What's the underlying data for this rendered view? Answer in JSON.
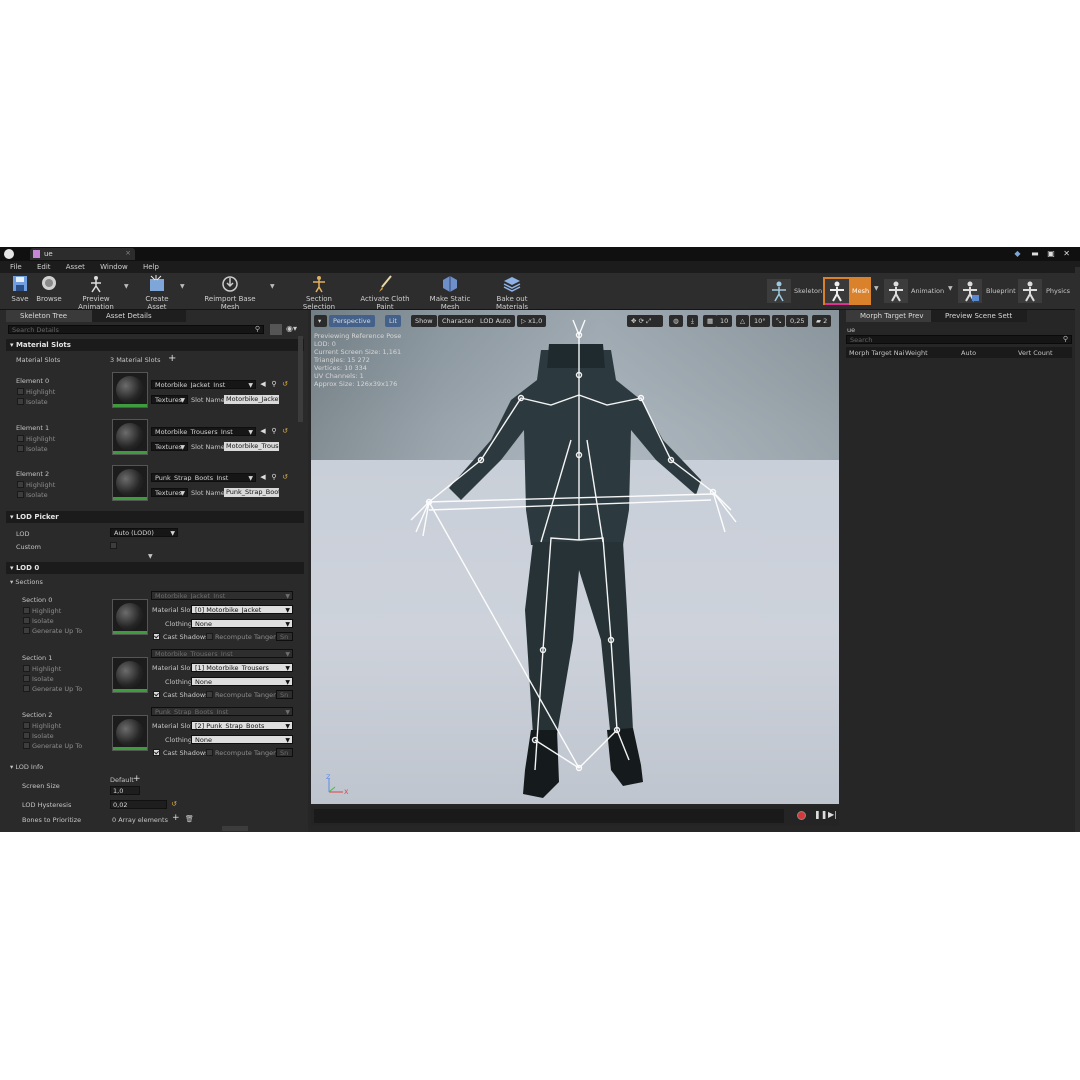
{
  "titlebar": {
    "tab_title": "ue",
    "window_buttons": [
      "minimize-icon",
      "maximize-icon",
      "close-icon"
    ]
  },
  "menu": [
    "File",
    "Edit",
    "Asset",
    "Window",
    "Help"
  ],
  "toolbar": {
    "save": "Save",
    "browse": "Browse",
    "preview_animation": "Preview Animation",
    "create_asset": "Create Asset",
    "reimport_base_mesh": "Reimport Base Mesh",
    "section_selection": "Section Selection",
    "activate_cloth_paint": "Activate Cloth Paint",
    "make_static_mesh": "Make Static Mesh",
    "bake_out_materials": "Bake out Materials"
  },
  "modes": {
    "skeleton": "Skeleton",
    "mesh": "Mesh",
    "animation": "Animation",
    "blueprint": "Blueprint",
    "physics": "Physics",
    "active": "Mesh"
  },
  "left_tabs": {
    "skeleton_tree": "Skeleton Tree",
    "asset_details": "Asset Details"
  },
  "details": {
    "search_placeholder": "Search Details",
    "material_slots": {
      "header": "Material Slots",
      "label": "Material Slots",
      "count": "3 Material Slots",
      "elements": [
        {
          "label": "Element 0",
          "material": "Motorbike_Jacket_Inst",
          "textures": "Textures",
          "slot_name_label": "Slot Name",
          "slot_name": "Motorbike_Jacket"
        },
        {
          "label": "Element 1",
          "material": "Motorbike_Trousers_Inst",
          "textures": "Textures",
          "slot_name_label": "Slot Name",
          "slot_name": "Motorbike_Trousers"
        },
        {
          "label": "Element 2",
          "material": "Punk_Strap_Boots_Inst",
          "textures": "Textures",
          "slot_name_label": "Slot Name",
          "slot_name": "Punk_Strap_Boots"
        }
      ],
      "highlight": "Highlight",
      "isolate": "Isolate"
    },
    "lod_picker": {
      "header": "LOD Picker",
      "lod_label": "LOD",
      "lod_value": "Auto (LOD0)",
      "custom_label": "Custom"
    },
    "lod0": {
      "header": "LOD 0",
      "sections_header": "Sections",
      "material_slot_label": "Material Slot",
      "clothing_label": "Clothing",
      "clothing_value": "None",
      "cast_shadows": "Cast Shadows",
      "recompute_tangent": "Recompute Tangent",
      "skin_cache": "Sn",
      "generate_up_to": "Generate Up To",
      "sections": [
        {
          "label": "Section 0",
          "material": "Motorbike_Jacket_Inst",
          "slot": "[0] Motorbike_Jacket"
        },
        {
          "label": "Section 1",
          "material": "Motorbike_Trousers_Inst",
          "slot": "[1] Motorbike_Trousers"
        },
        {
          "label": "Section 2",
          "material": "Punk_Strap_Boots_Inst",
          "slot": "[2] Punk_Strap_Boots"
        }
      ]
    },
    "lod_info": {
      "header": "LOD Info",
      "screen_size_label": "Screen Size",
      "screen_size_default": "Default",
      "screen_size_value": "1,0",
      "hysteresis_label": "LOD Hysteresis",
      "hysteresis_value": "0,02",
      "bones_label": "Bones to Prioritize",
      "bones_value": "0 Array elements"
    }
  },
  "viewport": {
    "perspective": "Perspective",
    "lit": "Lit",
    "show": "Show",
    "character": "Character",
    "lod_auto": "LOD Auto",
    "speed": "x1,0",
    "grid": "10",
    "angle": "10°",
    "scale": "0,25",
    "camera_speed": "2",
    "info": [
      "Previewing Reference Pose",
      "LOD: 0",
      "Current Screen Size: 1,161",
      "Triangles: 15 272",
      "Vertices: 10 334",
      "UV Channels: 1",
      "Approx Size: 126x39x176"
    ],
    "axis_x": "X",
    "axis_z": "Z"
  },
  "right_tabs": {
    "morph": "Morph Target Prev",
    "scene": "Preview Scene Sett"
  },
  "morph": {
    "filter_text": "ue",
    "search_placeholder": "Search",
    "columns": [
      "Morph Target Nai",
      "Weight",
      "Auto",
      "Vert Count"
    ]
  },
  "colors": {
    "active_mode": "#d9822b",
    "material_bar": "#3e9b3e",
    "accent_blue": "#43618a",
    "record_red": "#d23a3a"
  }
}
